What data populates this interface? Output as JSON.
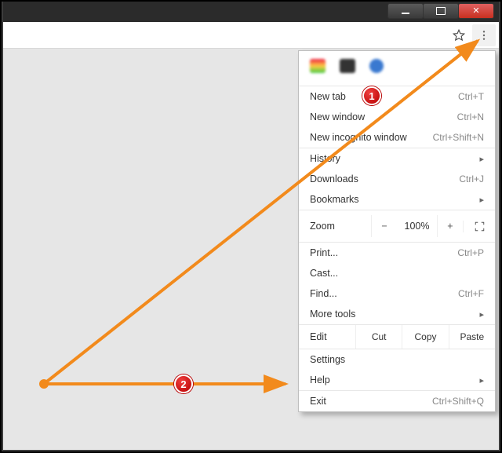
{
  "menu": {
    "new_tab": {
      "label": "New tab",
      "shortcut": "Ctrl+T"
    },
    "new_window": {
      "label": "New window",
      "shortcut": "Ctrl+N"
    },
    "new_incognito": {
      "label": "New incognito window",
      "shortcut": "Ctrl+Shift+N"
    },
    "history": {
      "label": "History"
    },
    "downloads": {
      "label": "Downloads",
      "shortcut": "Ctrl+J"
    },
    "bookmarks": {
      "label": "Bookmarks"
    },
    "zoom": {
      "label": "Zoom",
      "minus": "−",
      "pct": "100%",
      "plus": "+"
    },
    "print": {
      "label": "Print...",
      "shortcut": "Ctrl+P"
    },
    "cast": {
      "label": "Cast..."
    },
    "find": {
      "label": "Find...",
      "shortcut": "Ctrl+F"
    },
    "more_tools": {
      "label": "More tools"
    },
    "edit": {
      "label": "Edit",
      "cut": "Cut",
      "copy": "Copy",
      "paste": "Paste"
    },
    "settings": {
      "label": "Settings"
    },
    "help": {
      "label": "Help"
    },
    "exit": {
      "label": "Exit",
      "shortcut": "Ctrl+Shift+Q"
    }
  },
  "annotations": {
    "step1": "1",
    "step2": "2"
  }
}
